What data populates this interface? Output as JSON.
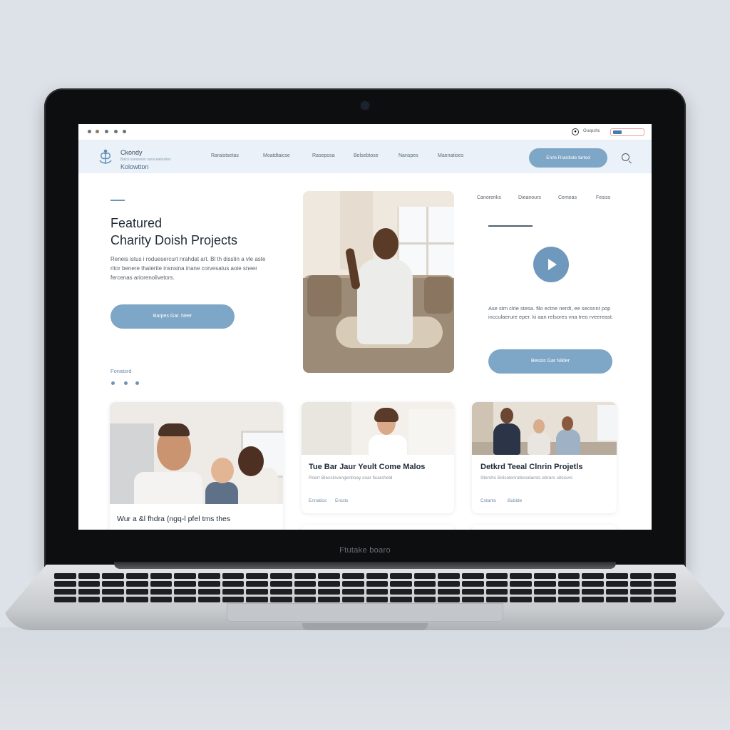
{
  "device": {
    "chin_label": "Ftutake boaro"
  },
  "browser": {
    "label": "Ouxpshc"
  },
  "nav": {
    "logo_name": "Ckondy",
    "logo_sub": "Balce sseswsnn ranoceaitesitex",
    "logo_name2": "Kolowtton",
    "links": [
      "Raraistsetas",
      "Moatdtaicse",
      "Raseposa",
      "Belsebtose",
      "Nanspes",
      "Maenatioes"
    ],
    "cta_label": "Enrls Rrardiste tarted"
  },
  "hero": {
    "title_line1": "Featured",
    "title_line2": "Charity Doish Projects",
    "text": "Reneis istus i roduesercurt nrahdat art. Bl th disstin a vle aste ritor benere thaterite insnsina inane corvesatus aoie sneer fercenas ariorenolivetors.",
    "button_label": "Barpes Gar. Neer",
    "caption": "Fonatsrd"
  },
  "side": {
    "tabs": [
      "Canoreriks",
      "Dieanours",
      "Cemeas",
      "Fesiss"
    ],
    "text": "Ase stm clrie stesa. filo ectne nerdt, ee secsnnt pop incculaerure eper. ki aan relsores vna treo rveereast.",
    "button_label": "Bessis Gar Nikler"
  },
  "cards": [
    {
      "title": "Wur a &l fhdra (ngq-l pfel tms thes"
    },
    {
      "title": "Tue Bar Jaur Yeult Come Malos",
      "sub": "Rserr Biecsinvengenlloay snar ficarsheld",
      "meta_a": "Ennatios",
      "meta_b": "Erosts"
    },
    {
      "title": "Detkrd Teeal Clnrin Projetls",
      "sub": "Sterchs Bolsolenrafesodarsts ebrars sitsisvis",
      "meta_a": "Cstants",
      "meta_b": "Bubide"
    }
  ],
  "colors": {
    "accent": "#7ea6c6",
    "nav_bg": "#eaf1f8",
    "text_dark": "#1f2a36"
  },
  "icons": [
    "logo-mark-icon",
    "search-icon",
    "play-icon",
    "browser-status-icon"
  ]
}
